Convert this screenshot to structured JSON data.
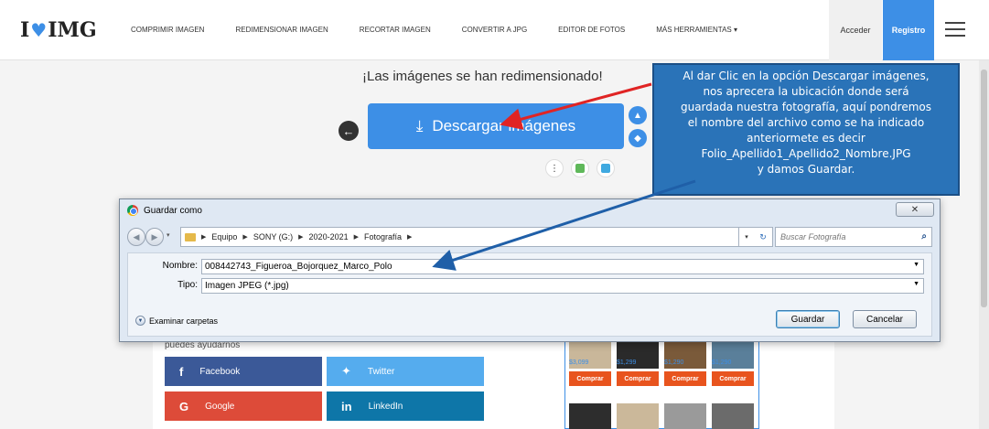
{
  "brand": {
    "logo_left": "I",
    "logo_right": "IMG"
  },
  "nav": {
    "items": [
      "COMPRIMIR IMAGEN",
      "REDIMENSIONAR IMAGEN",
      "RECORTAR IMAGEN",
      "CONVERTIR A JPG",
      "EDITOR DE FOTOS",
      "MÁS HERRAMIENTAS ▾"
    ],
    "login": "Acceder",
    "signup": "Registro"
  },
  "result": {
    "message": "¡Las imágenes se han redimensionado!",
    "download_label": "Descargar imágenes"
  },
  "callout": {
    "lines": [
      "Al dar Clic en la opción Descargar imágenes,",
      "nos aprecera la ubicación donde será",
      "guardada nuestra fotografía, aquí pondremos",
      "el nombre del archivo como se ha indicado",
      "anteriormete es decir",
      "Folio_Apellido1_Apellido2_Nombre.JPG",
      "y damos Guardar."
    ]
  },
  "dialog": {
    "title": "Guardar como",
    "close": "✕",
    "path": [
      "Equipo",
      "SONY (G:)",
      "2020-2021",
      "Fotografía"
    ],
    "search_placeholder": "Buscar Fotografía",
    "name_label": "Nombre:",
    "name_value": "008442743_Figueroa_Bojorquez_Marco_Polo",
    "type_label": "Tipo:",
    "type_value": "Imagen JPEG (*.jpg)",
    "browse": "Examinar carpetas",
    "save": "Guardar",
    "cancel": "Cancelar"
  },
  "share": {
    "help_text": "puedes ayudarnos",
    "facebook": "Facebook",
    "twitter": "Twitter",
    "google": "Google",
    "linkedin": "LinkedIn"
  },
  "ads": {
    "prices": [
      "$3,099",
      "$1,299",
      "$1,290",
      "$1,290"
    ],
    "buy": "Comprar"
  },
  "colors": {
    "brand_blue": "#3d8fe6",
    "callout_blue": "#2a73b8",
    "arrow_red": "#e02424",
    "arrow_blue": "#1f5fa8"
  }
}
